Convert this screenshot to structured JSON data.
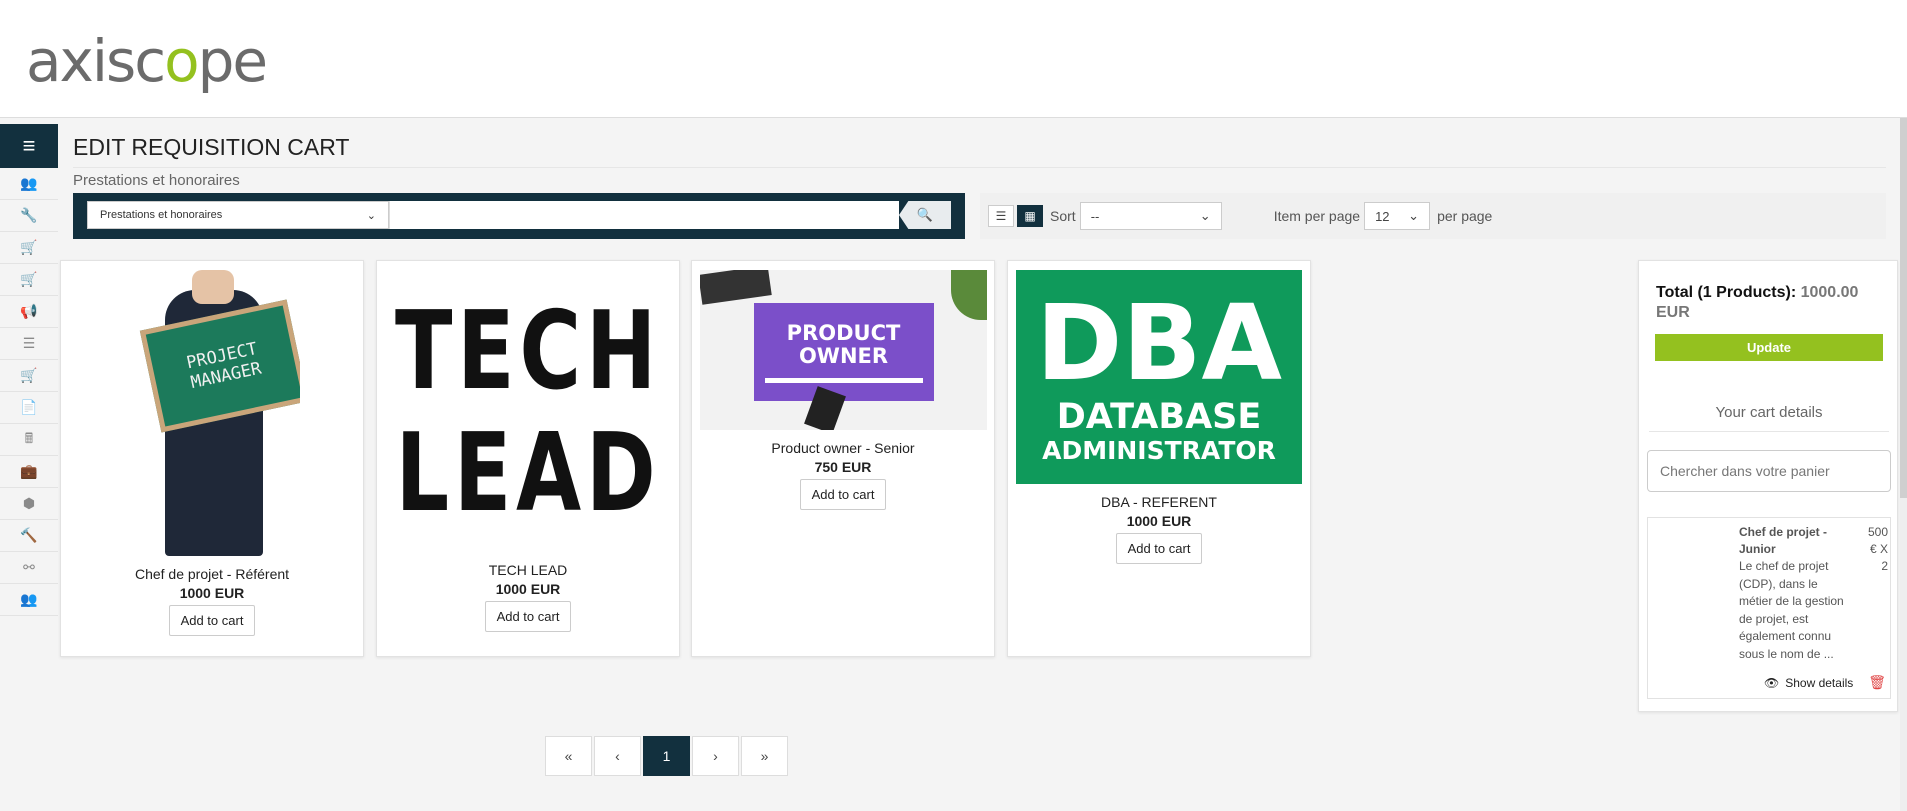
{
  "brand": {
    "logo_prefix": "axisc",
    "logo_o": "o",
    "logo_suffix": "pe"
  },
  "sidebar": {
    "menu_icon": "menu-icon",
    "items": [
      {
        "icon": "users-icon",
        "glyph": "👥"
      },
      {
        "icon": "wrench-icon",
        "glyph": "🔧"
      },
      {
        "icon": "cart-icon",
        "glyph": "🛒"
      },
      {
        "icon": "cart-icon",
        "glyph": "🛒"
      },
      {
        "icon": "megaphone-icon",
        "glyph": "📢"
      },
      {
        "icon": "list-icon",
        "glyph": "☰"
      },
      {
        "icon": "cart-icon",
        "glyph": "🛒"
      },
      {
        "icon": "document-icon",
        "glyph": "📄"
      },
      {
        "icon": "calculator-icon",
        "glyph": "🖩"
      },
      {
        "icon": "briefcase-icon",
        "glyph": "💼"
      },
      {
        "icon": "cube-icon",
        "glyph": "⬢"
      },
      {
        "icon": "gavel-icon",
        "glyph": "🔨"
      },
      {
        "icon": "flow-icon",
        "glyph": "⚯"
      },
      {
        "icon": "group-icon",
        "glyph": "👥"
      }
    ]
  },
  "page": {
    "title": "EDIT REQUISITION CART",
    "subtitle": "Prestations et honoraires"
  },
  "search": {
    "category_value": "Prestations et honoraires",
    "query": ""
  },
  "toolbar": {
    "sort_label": "Sort",
    "sort_value": "--",
    "items_per_page_label": "Item per page",
    "items_per_page_value": "12",
    "per_page_label": "per page"
  },
  "products": [
    {
      "name": "Chef de projet - Référent",
      "price": "1000 EUR",
      "button": "Add to cart",
      "image_text": "PROJECT MANAGER"
    },
    {
      "name": "TECH LEAD",
      "price": "1000 EUR",
      "button": "Add to cart",
      "image_line1": "TECH",
      "image_line2": "LEAD"
    },
    {
      "name": "Product owner - Senior",
      "price": "750 EUR",
      "button": "Add to cart",
      "image_line1": "PRODUCT",
      "image_line2": "OWNER"
    },
    {
      "name": "DBA - REFERENT",
      "price": "1000 EUR",
      "button": "Add to cart",
      "image_line1": "DBA",
      "image_line2": "DATABASE",
      "image_line3": "ADMINISTRATOR"
    }
  ],
  "cart": {
    "total_label": "Total (1 Products):",
    "total_value": "1000.00 EUR",
    "update_button": "Update",
    "details_title": "Your cart details",
    "search_placeholder": "Chercher dans votre panier",
    "item": {
      "name": "Chef de projet - Junior",
      "qty": "500 € X 2",
      "description": "Le chef de projet (CDP), dans le métier de la gestion de projet, est également connu sous le nom de ...",
      "show_details": "Show details"
    }
  },
  "pagination": {
    "first": "«",
    "prev": "‹",
    "current": "1",
    "next": "›",
    "last": "»"
  },
  "colors": {
    "navy": "#12303e",
    "green": "#94c11f",
    "danger": "#e04545"
  }
}
